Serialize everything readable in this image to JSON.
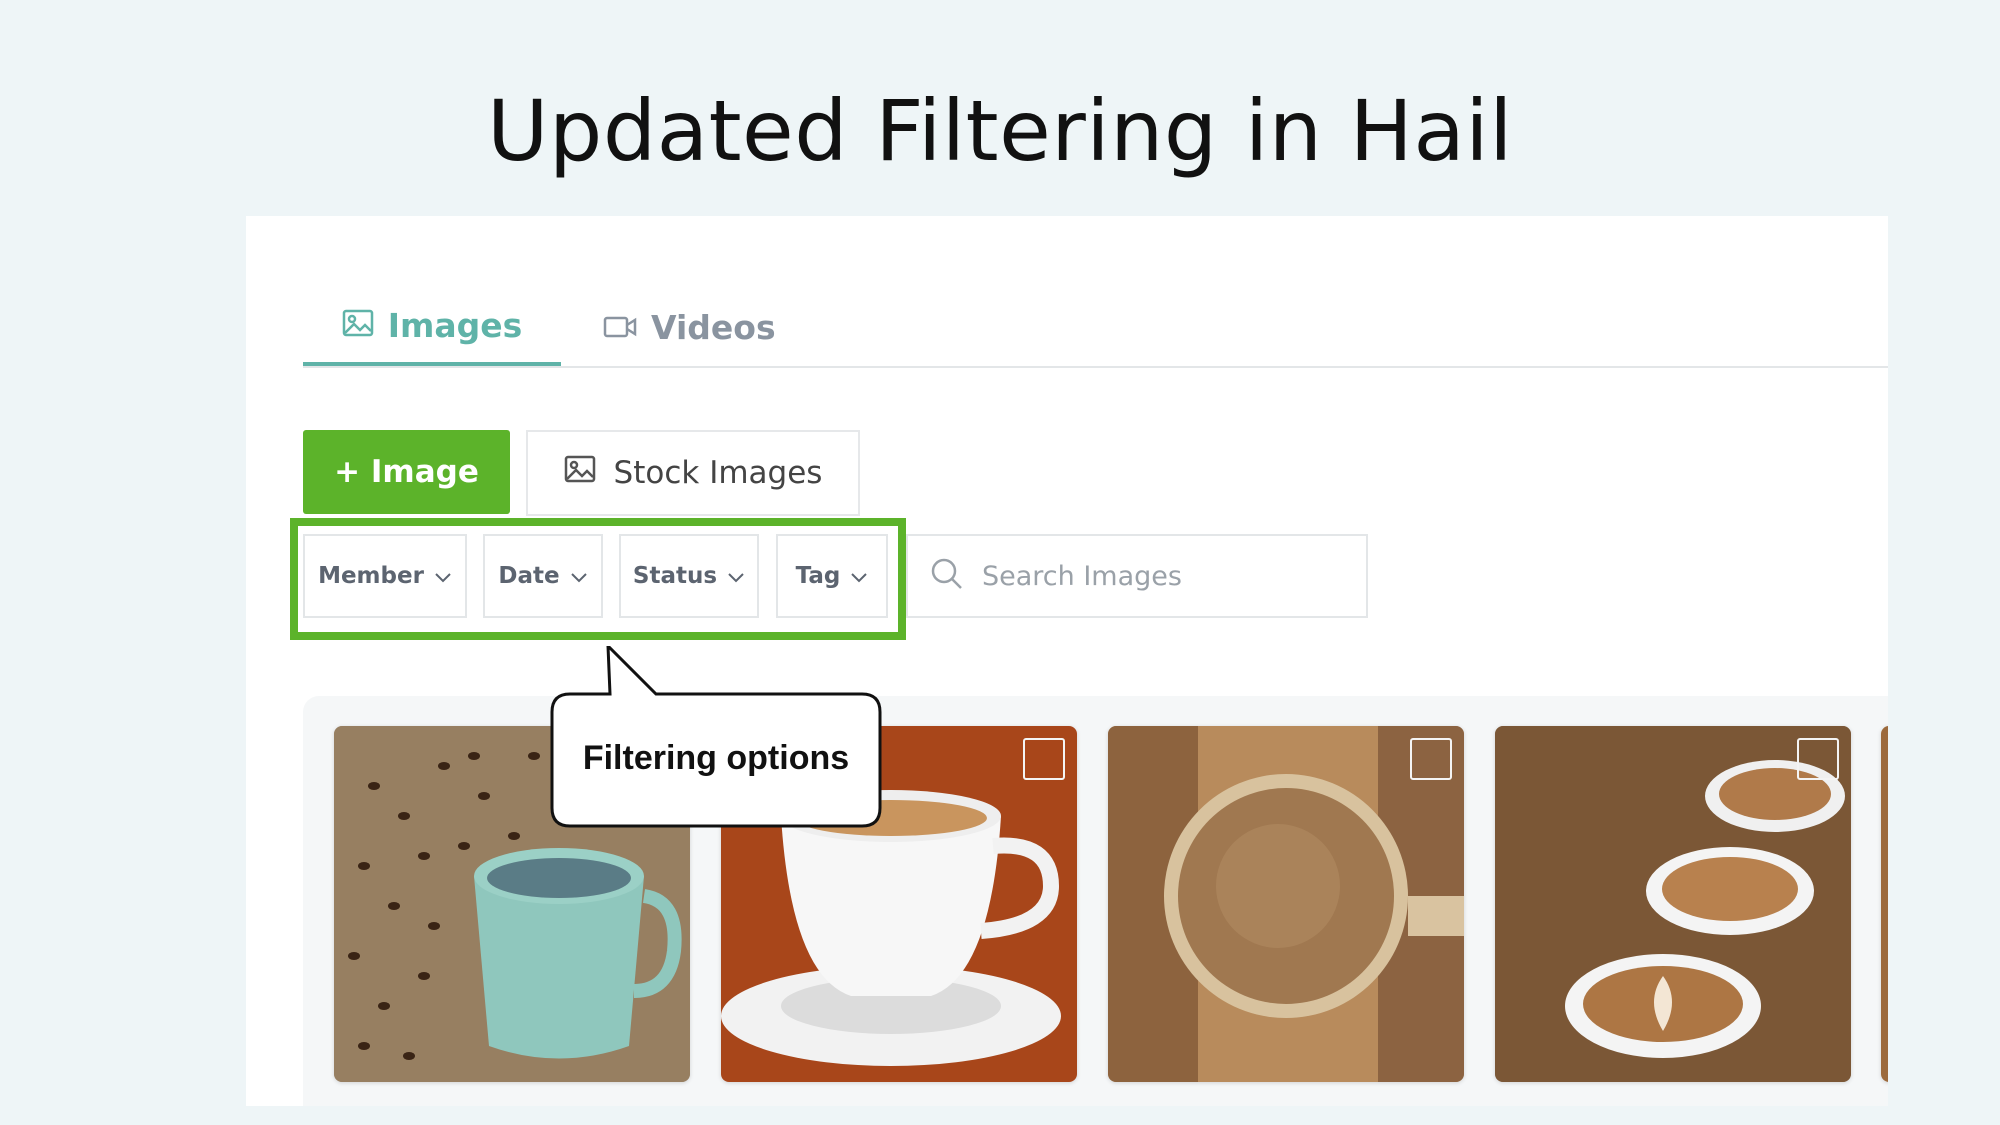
{
  "headline": "Updated Filtering in Hail",
  "tabs": [
    {
      "label": "Images",
      "icon": "image-icon",
      "active": true
    },
    {
      "label": "Videos",
      "icon": "video-icon",
      "active": false
    }
  ],
  "toolbar": {
    "add_label": "+ Image",
    "stock_label": "Stock Images"
  },
  "filters": [
    {
      "label": "Member"
    },
    {
      "label": "Date"
    },
    {
      "label": "Status"
    },
    {
      "label": "Tag"
    }
  ],
  "search": {
    "placeholder": "Search Images"
  },
  "callout": {
    "text": "Filtering options"
  },
  "colors": {
    "accent": "#5cb32a",
    "tab_active": "#5fb3a8",
    "background": "#eef5f7"
  }
}
